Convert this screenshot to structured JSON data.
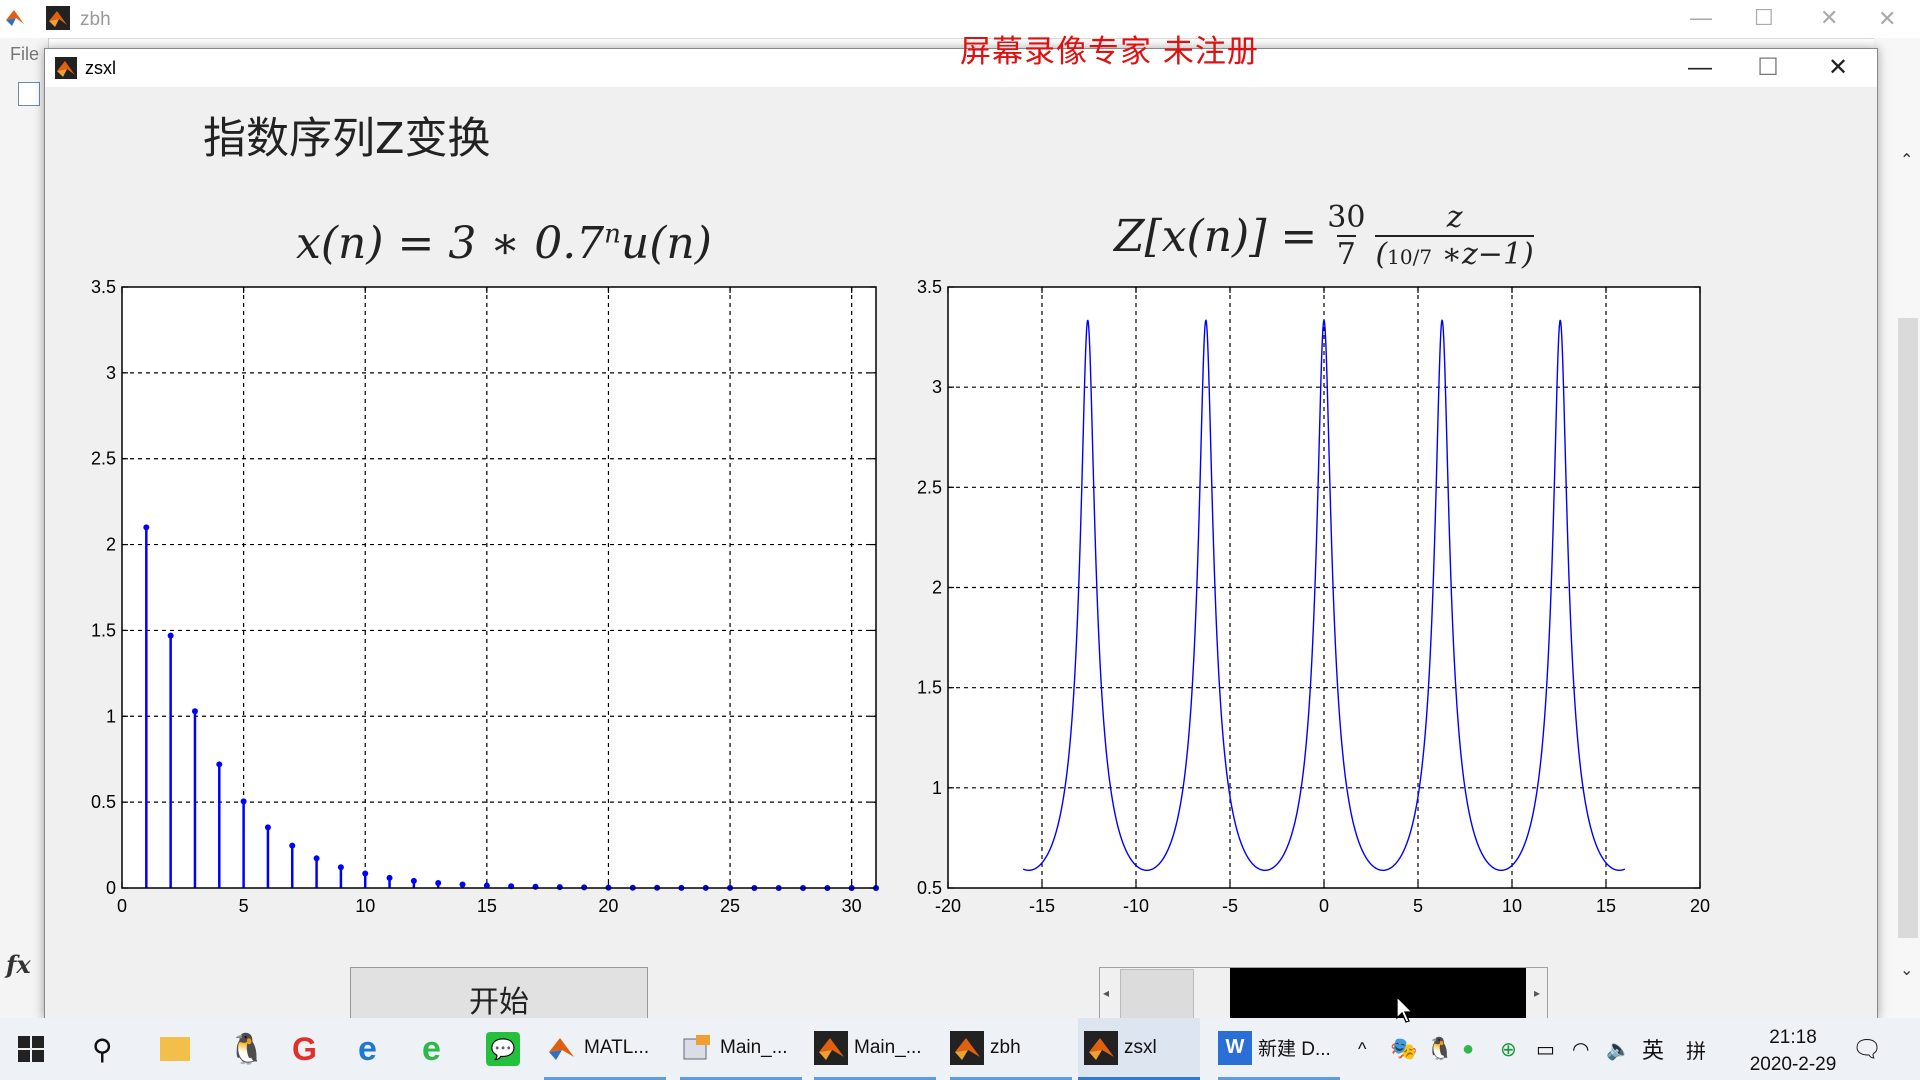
{
  "bg_window": {
    "title": "zbh",
    "menu_file": "File"
  },
  "watermark": "屏幕录像专家  未注册",
  "figure": {
    "title": "zsxl",
    "heading": "指数序列Z变换",
    "buttons": {
      "start": "开始"
    }
  },
  "window_controls": {
    "minimize": "—",
    "maximize": "☐",
    "close": "✕"
  },
  "chart_data": [
    {
      "type": "stem",
      "title": "x(n) = 3*0.7^n u(n)",
      "x": [
        1,
        2,
        3,
        4,
        5,
        6,
        7,
        8,
        9,
        10,
        11,
        12,
        13,
        14,
        15,
        16,
        17,
        18,
        19,
        20,
        21,
        22,
        23,
        24,
        25,
        26,
        27,
        28,
        29,
        30,
        31
      ],
      "y": [
        2.1,
        1.47,
        1.029,
        0.7203,
        0.5042,
        0.3529,
        0.2471,
        0.1729,
        0.1211,
        0.0847,
        0.0593,
        0.0415,
        0.0291,
        0.0203,
        0.0142,
        0.01,
        0.007,
        0.0049,
        0.0034,
        0.0024,
        0.0017,
        0.0012,
        0.0008,
        0.0006,
        0.0004,
        0.0003,
        0.0002,
        0.0001,
        0.0001,
        0.0001,
        0.0
      ],
      "xlim": [
        0,
        31
      ],
      "ylim": [
        0,
        3.5
      ],
      "xticks": [
        "0",
        "5",
        "10",
        "15",
        "20",
        "25",
        "30"
      ],
      "yticks": [
        "0",
        "0.5",
        "1",
        "1.5",
        "2",
        "2.5",
        "3",
        "3.5"
      ],
      "grid": true,
      "color": "#0000ff"
    },
    {
      "type": "line",
      "title": "Z[x(n)] = 30/7 · z/(10/7·z − 1)",
      "function": "|z/(z-0.7)| on unit circle, w from -16 to 16",
      "x_range": [
        -16,
        16
      ],
      "peak_positions": [
        -12.566,
        -6.283,
        0,
        6.283,
        12.566
      ],
      "peak_value": 3.333,
      "trough_value": 0.588,
      "xlim": [
        -20,
        20
      ],
      "ylim": [
        0.5,
        3.5
      ],
      "xticks": [
        "-20",
        "-15",
        "-10",
        "-5",
        "0",
        "5",
        "10",
        "15",
        "20"
      ],
      "yticks": [
        "0.5",
        "1",
        "1.5",
        "2",
        "2.5",
        "3",
        "3.5"
      ],
      "grid": true,
      "color": "#0000ff"
    }
  ],
  "taskbar": {
    "items": [
      "MATL...",
      "Main_...",
      "Main_...",
      "zbh",
      "zsxl",
      "新建 D..."
    ],
    "ime": "英",
    "ime2": "拼",
    "time": "21:18",
    "date": "2020-2-29"
  }
}
